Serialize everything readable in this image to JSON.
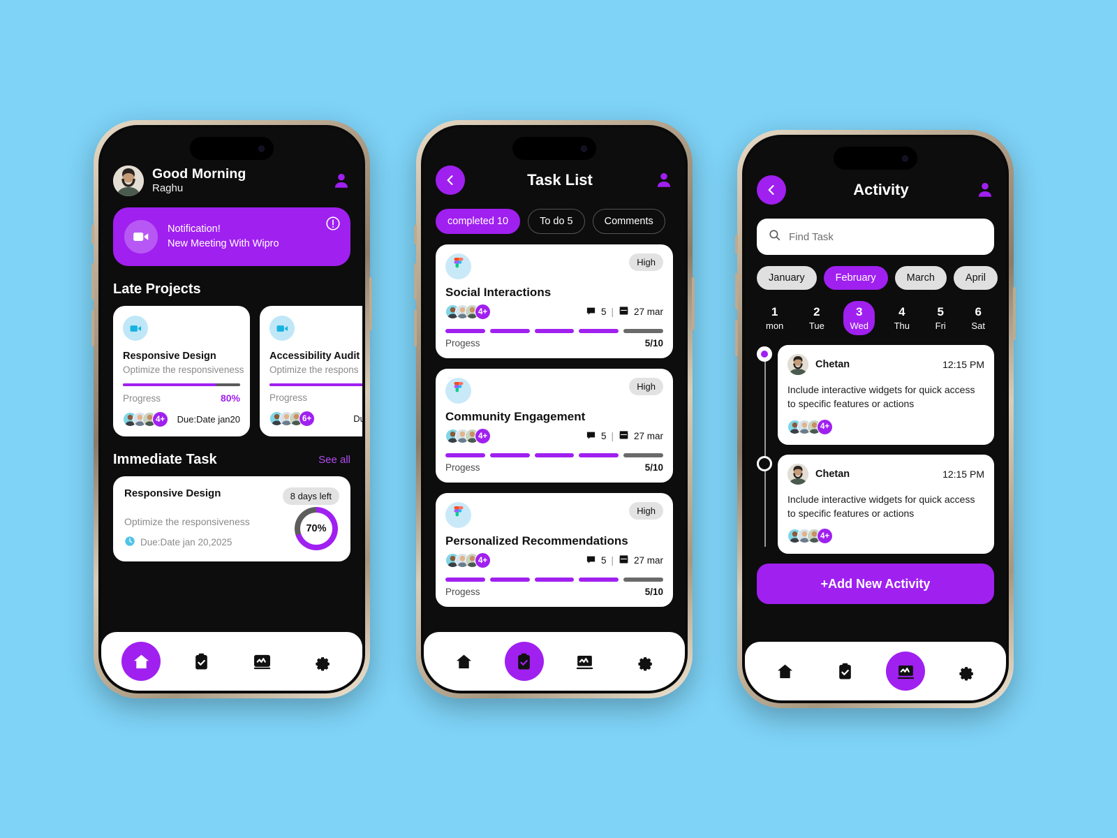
{
  "theme": {
    "page_background": "#7ed3f7",
    "accent_purple": "#a020f0",
    "screen_background": "#0d0d0d",
    "card_white": "#ffffff",
    "chip_grey": "#e0e0e0"
  },
  "phone1": {
    "greeting": "Good Morning",
    "user_name": "Raghu",
    "profile_icon": "person-icon",
    "notification": {
      "icon": "video-camera-icon",
      "warn_icon": "exclamation-circle-icon",
      "line1": "Notification!",
      "line2": "New Meeting With Wipro"
    },
    "late_projects": {
      "title": "Late Projects",
      "cards": [
        {
          "icon": "video-camera-icon",
          "name": "Responsive Design",
          "desc": "Optimize the responsiveness",
          "progress_label": "Progress",
          "progress_value": "80%",
          "progress_pct": 80,
          "members_more": "4+",
          "due": "Due:Date jan20"
        },
        {
          "icon": "video-camera-icon",
          "name": "Accessibility Audit",
          "desc": "Optimize the respons",
          "progress_label": "Progress",
          "progress_value": "",
          "progress_pct": 100,
          "members_more": "6+",
          "due": "Due:Dat"
        }
      ]
    },
    "immediate": {
      "title": "Immediate  Task",
      "see_all": "See all",
      "card": {
        "name": "Responsive Design",
        "days_left": "8 days left",
        "desc": "Optimize the responsiveness",
        "due_icon": "clock-icon",
        "due": "Due:Date jan 20,2025",
        "ring_value": "70%",
        "ring_pct": 70
      }
    },
    "nav": [
      {
        "icon": "home-icon",
        "active": true
      },
      {
        "icon": "clipboard-check-icon",
        "active": false
      },
      {
        "icon": "activity-chart-icon",
        "active": false
      },
      {
        "icon": "gear-icon",
        "active": false
      }
    ]
  },
  "phone2": {
    "back_icon": "chevron-left-icon",
    "title": "Task List",
    "profile_icon": "person-icon",
    "filters": [
      {
        "label": "completed 10",
        "active": true
      },
      {
        "label": "To do 5",
        "active": false
      },
      {
        "label": "Comments",
        "active": false
      }
    ],
    "tasks": [
      {
        "icon": "figma-icon",
        "priority": "High",
        "name": "Social Interactions",
        "members_more": "4+",
        "comments_icon": "comment-icon",
        "comments": "5",
        "separator": "|",
        "date_icon": "calendar-icon",
        "date": "27 mar",
        "progress_label": "Progess",
        "progress_value": "5/10",
        "segments_total": 5,
        "segments_done": 4
      },
      {
        "icon": "figma-icon",
        "priority": "High",
        "name": "Community Engagement",
        "members_more": "4+",
        "comments_icon": "comment-icon",
        "comments": "5",
        "separator": "|",
        "date_icon": "calendar-icon",
        "date": "27 mar",
        "progress_label": "Progess",
        "progress_value": "5/10",
        "segments_total": 5,
        "segments_done": 4
      },
      {
        "icon": "figma-icon",
        "priority": "High",
        "name": "Personalized Recommendations",
        "members_more": "4+",
        "comments_icon": "comment-icon",
        "comments": "5",
        "separator": "|",
        "date_icon": "calendar-icon",
        "date": "27 mar",
        "progress_label": "Progess",
        "progress_value": "5/10",
        "segments_total": 5,
        "segments_done": 4
      }
    ],
    "nav": [
      {
        "icon": "home-icon",
        "active": false
      },
      {
        "icon": "clipboard-check-icon",
        "active": true
      },
      {
        "icon": "activity-chart-icon",
        "active": false
      },
      {
        "icon": "gear-icon",
        "active": false
      }
    ]
  },
  "phone3": {
    "back_icon": "chevron-left-icon",
    "title": "Activity",
    "profile_icon": "person-icon",
    "search": {
      "icon": "search-icon",
      "placeholder": "Find Task",
      "value": ""
    },
    "months": [
      {
        "label": "January",
        "active": false
      },
      {
        "label": "February",
        "active": true
      },
      {
        "label": "March",
        "active": false
      },
      {
        "label": "April",
        "active": false
      }
    ],
    "days": [
      {
        "num": "1",
        "name": "mon",
        "active": false
      },
      {
        "num": "2",
        "name": "Tue",
        "active": false
      },
      {
        "num": "3",
        "name": "Wed",
        "active": true
      },
      {
        "num": "4",
        "name": "Thu",
        "active": false
      },
      {
        "num": "5",
        "name": "Fri",
        "active": false
      },
      {
        "num": "6",
        "name": "Sat",
        "active": false
      }
    ],
    "activities": [
      {
        "author": "Chetan",
        "time": "12:15 PM",
        "text": "Include interactive widgets for quick access to specific features or actions",
        "members_more": "4+",
        "dot_filled": true
      },
      {
        "author": "Chetan",
        "time": "12:15 PM",
        "text": "Include interactive widgets for quick access to specific features or actions",
        "members_more": "4+",
        "dot_filled": false
      }
    ],
    "add_button": "+Add New Activity",
    "nav": [
      {
        "icon": "home-icon",
        "active": false
      },
      {
        "icon": "clipboard-check-icon",
        "active": false
      },
      {
        "icon": "activity-chart-icon",
        "active": true
      },
      {
        "icon": "gear-icon",
        "active": false
      }
    ]
  }
}
